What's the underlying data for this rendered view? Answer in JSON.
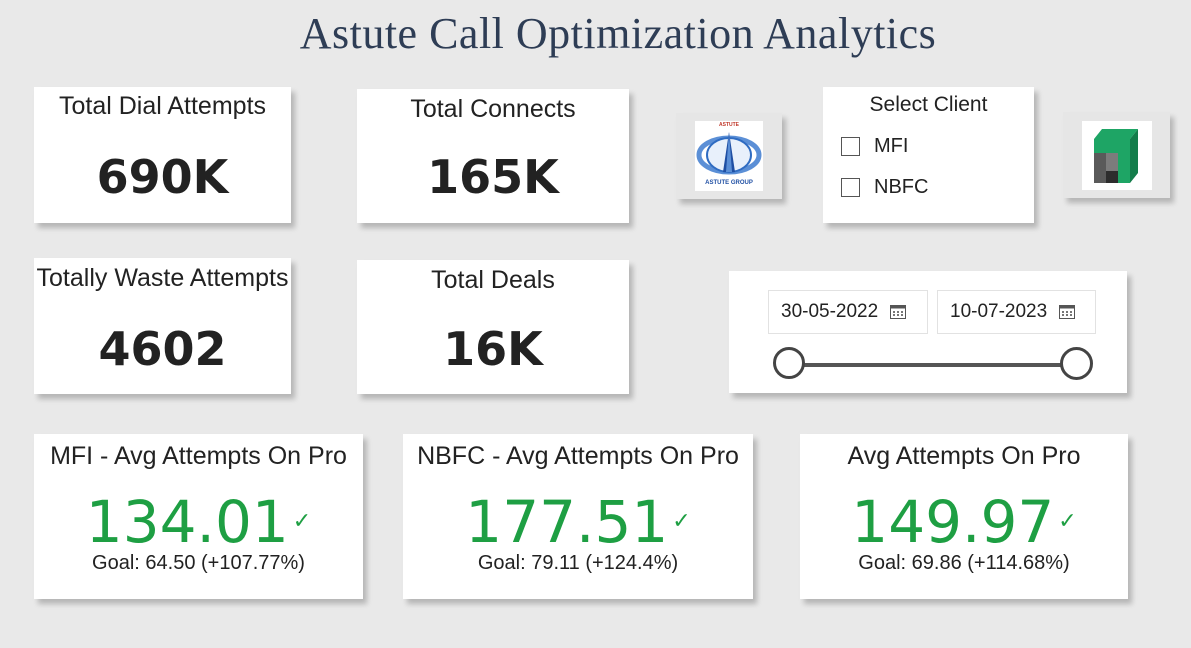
{
  "header": {
    "title": "Astute Call Optimization Analytics"
  },
  "kpis": {
    "dial_attempts": {
      "label": "Total Dial Attempts",
      "value": "690K"
    },
    "connects": {
      "label": "Total Connects",
      "value": "165K"
    },
    "waste_attempts": {
      "label": "Totally Waste Attempts",
      "value": "4602"
    },
    "deals": {
      "label": "Total Deals",
      "value": "16K"
    }
  },
  "goals": {
    "mfi": {
      "label": "MFI - Avg Attempts On Pro",
      "value": "134.01",
      "goal": "Goal: 64.50 (+107.77%)"
    },
    "nbfc": {
      "label": "NBFC - Avg Attempts On Pro",
      "value": "177.51",
      "goal": "Goal: 79.11 (+124.4%)"
    },
    "overall": {
      "label": "Avg Attempts On Pro",
      "value": "149.97",
      "goal": "Goal: 69.86 (+114.68%)"
    }
  },
  "client_slicer": {
    "title": "Select Client",
    "options": [
      {
        "label": "MFI",
        "checked": false
      },
      {
        "label": "NBFC",
        "checked": false
      }
    ]
  },
  "date_slicer": {
    "start": "30-05-2022",
    "end": "10-07-2023"
  },
  "logos": {
    "astute_top": "ASTUTE",
    "astute_bottom": "ASTUTE GROUP"
  },
  "colors": {
    "goal_green": "#1e9f43",
    "title": "#2e3d55",
    "background": "#e9e9e9"
  }
}
